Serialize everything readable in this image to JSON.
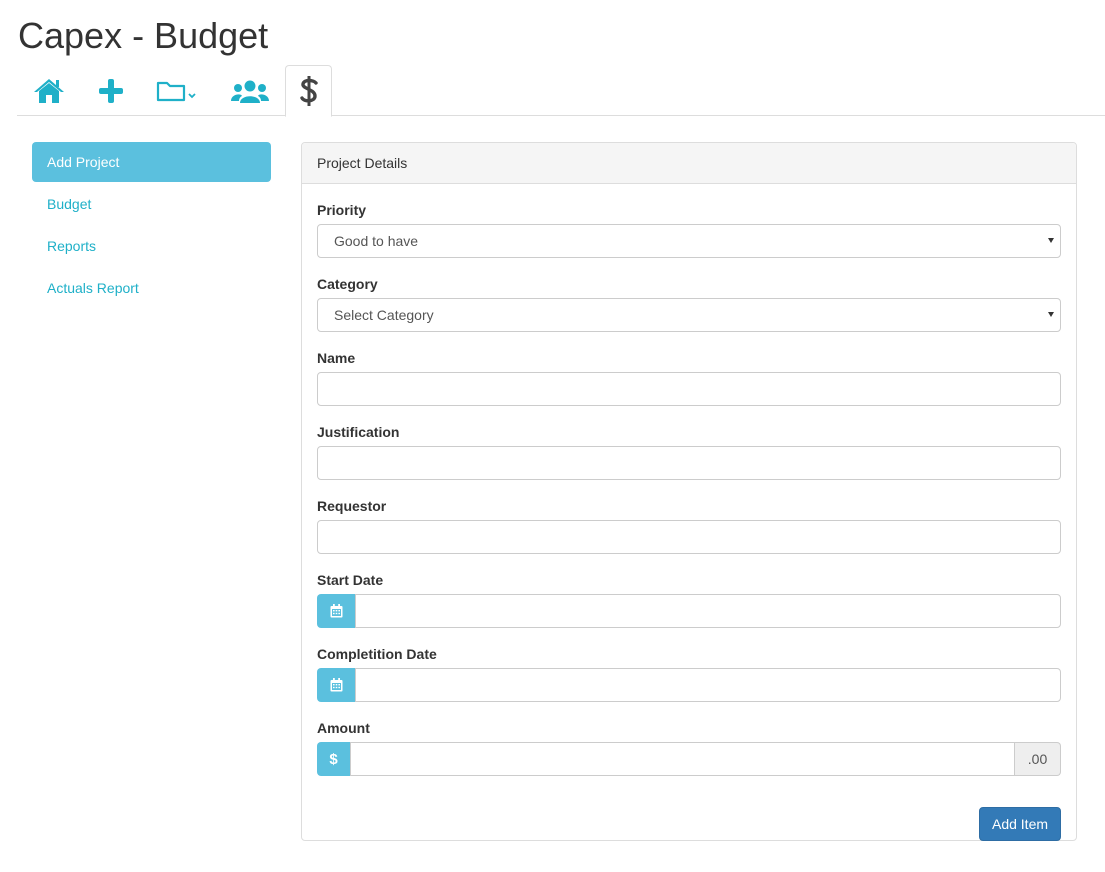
{
  "page": {
    "title": "Capex - Budget"
  },
  "tabs": [
    {
      "icon": "home-icon",
      "active": false
    },
    {
      "icon": "plus-icon",
      "active": false
    },
    {
      "icon": "folder-dropdown-icon",
      "active": false
    },
    {
      "icon": "users-icon",
      "active": false
    },
    {
      "icon": "dollar-icon",
      "active": true
    }
  ],
  "colors": {
    "accent": "#1fb0c8",
    "info": "#5bc0de",
    "primary": "#337ab7",
    "active_tab_icon": "#444444"
  },
  "sidebar": {
    "items": [
      {
        "label": "Add Project",
        "active": true
      },
      {
        "label": "Budget",
        "active": false
      },
      {
        "label": "Reports",
        "active": false
      },
      {
        "label": "Actuals Report",
        "active": false
      }
    ]
  },
  "panel": {
    "heading": "Project Details",
    "priority": {
      "label": "Priority",
      "value": "Good to have"
    },
    "category": {
      "label": "Category",
      "value": "Select Category"
    },
    "name": {
      "label": "Name",
      "value": ""
    },
    "justification": {
      "label": "Justification",
      "value": ""
    },
    "requestor": {
      "label": "Requestor",
      "value": ""
    },
    "start_date": {
      "label": "Start Date",
      "value": "",
      "icon": "calendar-icon"
    },
    "completion_date": {
      "label": "Completition Date",
      "value": "",
      "icon": "calendar-icon"
    },
    "amount": {
      "label": "Amount",
      "value": "",
      "prefix": "$",
      "suffix": ".00"
    },
    "submit_label": "Add Item"
  }
}
